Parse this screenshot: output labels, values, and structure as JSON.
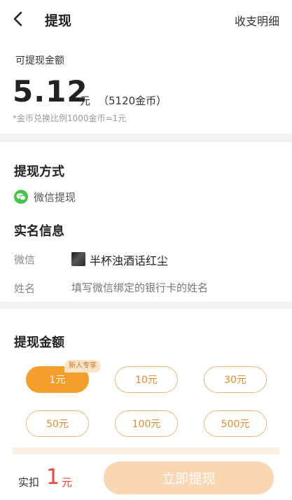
{
  "header": {
    "title": "提现",
    "details_link": "收支明细"
  },
  "balance": {
    "label": "可提现金额",
    "amount": "5.12",
    "unit": "元",
    "coins": "（5120金币）",
    "note": "*金币兑换比例1000金币=1元"
  },
  "method": {
    "title": "提现方式",
    "option": "微信提现",
    "icon": "wechat-icon",
    "icon_color": "#44c44a"
  },
  "realname": {
    "title": "实名信息",
    "wechat_label": "微信",
    "wechat_nickname": "半杯浊酒话红尘",
    "name_label": "姓名",
    "name_placeholder": "填写微信绑定的银行卡的姓名",
    "name_value": ""
  },
  "amounts": {
    "title": "提现金额",
    "badge": "新人专享",
    "selected_index": 0,
    "options": [
      "1元",
      "10元",
      "30元",
      "50元",
      "100元",
      "500元"
    ]
  },
  "footer": {
    "pay_label": "实扣",
    "pay_amount": "1",
    "pay_unit": "元",
    "submit_label": "立即提现"
  },
  "colors": {
    "accent": "#f59e2b",
    "accent_light": "#fbd6b3",
    "price": "#f0463a"
  }
}
